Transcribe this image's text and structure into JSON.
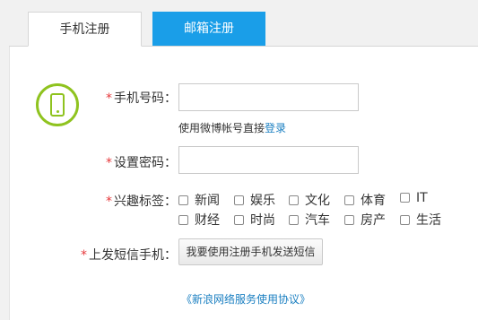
{
  "tabs": {
    "phone": "手机注册",
    "email": "邮箱注册"
  },
  "form": {
    "required_mark": "*",
    "phone_label": "手机号码：",
    "phone_hint_prefix": "使用微博帐号直接",
    "phone_hint_link": "登录",
    "password_label": "设置密码：",
    "tags_label": "兴趣标签：",
    "tags": [
      "新闻",
      "娱乐",
      "文化",
      "体育",
      "IT",
      "财经",
      "时尚",
      "汽车",
      "房产",
      "生活"
    ],
    "sms_label": "上发短信手机：",
    "sms_button": "我要使用注册手机发送短信",
    "protocol_link": "《新浪网络服务使用协议》"
  },
  "colors": {
    "active_tab_bg": "#1a9ee8",
    "icon_green": "#8fc31f",
    "required_red": "#e6383b",
    "link_blue": "#1a7fc1"
  },
  "icons": {
    "phone": "smartphone-icon"
  }
}
